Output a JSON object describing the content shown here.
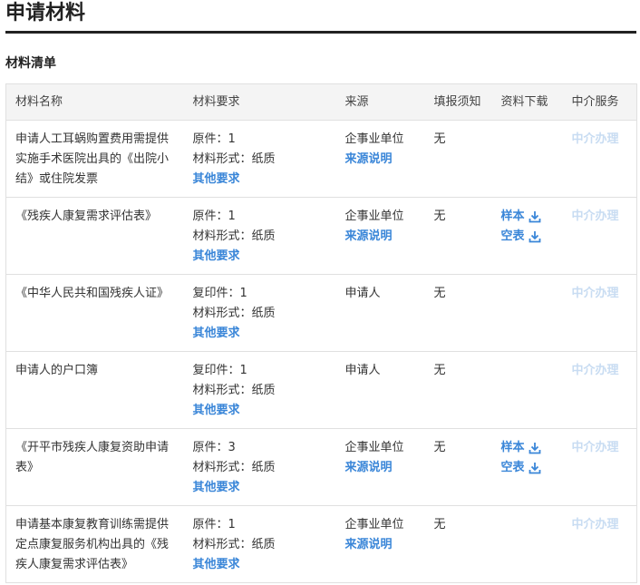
{
  "page": {
    "title": "申请材料"
  },
  "section": {
    "title": "材料清单"
  },
  "table": {
    "headers": [
      "材料名称",
      "材料要求",
      "来源",
      "填报须知",
      "资料下载",
      "中介服务"
    ],
    "rows": [
      {
        "name": "申请人工耳蜗购置费用需提供实施手术医院出具的《出院小结》或住院发票",
        "copies": "原件：1",
        "format": "材料形式：纸质",
        "other": "其他要求",
        "source": "企事业单位",
        "source_link": "来源说明",
        "notice": "无",
        "sample": "",
        "blank": "",
        "agent": "中介办理"
      },
      {
        "name": "《残疾人康复需求评估表》",
        "copies": "原件：1",
        "format": "材料形式：纸质",
        "other": "其他要求",
        "source": "企事业单位",
        "source_link": "来源说明",
        "notice": "无",
        "sample": "样本",
        "blank": "空表",
        "agent": "中介办理"
      },
      {
        "name": "《中华人民共和国残疾人证》",
        "copies": "复印件：1",
        "format": "材料形式：纸质",
        "other": "其他要求",
        "source": "申请人",
        "source_link": "",
        "notice": "无",
        "sample": "",
        "blank": "",
        "agent": "中介办理"
      },
      {
        "name": "申请人的户口簿",
        "copies": "复印件：1",
        "format": "材料形式：纸质",
        "other": "其他要求",
        "source": "申请人",
        "source_link": "",
        "notice": "无",
        "sample": "",
        "blank": "",
        "agent": "中介办理"
      },
      {
        "name": "《开平市残疾人康复资助申请表》",
        "copies": "原件：3",
        "format": "材料形式：纸质",
        "other": "其他要求",
        "source": "企事业单位",
        "source_link": "来源说明",
        "notice": "无",
        "sample": "样本",
        "blank": "空表",
        "agent": "中介办理"
      },
      {
        "name": "申请基本康复教育训练需提供定点康复服务机构出具的《残疾人康复需求评估表》",
        "copies": "原件：1",
        "format": "材料形式：纸质",
        "other": "其他要求",
        "source": "企事业单位",
        "source_link": "来源说明",
        "notice": "无",
        "sample": "",
        "blank": "",
        "agent": "中介办理"
      }
    ]
  },
  "colors": {
    "link": "#3a86d8",
    "agent_disabled": "#c8dcf2",
    "header_bg": "#f4f4f4",
    "rule": "#222222"
  },
  "icons": {
    "download": "download-icon"
  }
}
